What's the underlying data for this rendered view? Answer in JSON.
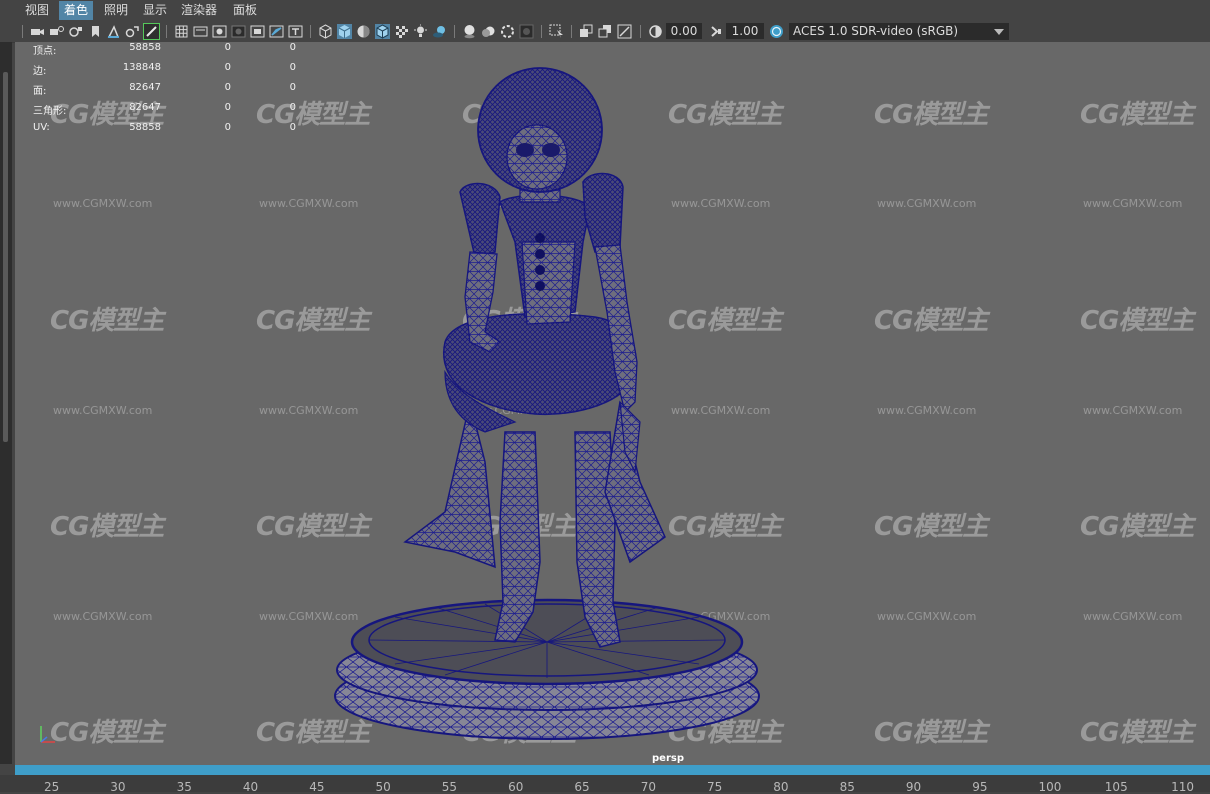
{
  "menu": {
    "items": [
      {
        "label": "视图"
      },
      {
        "label": "着色",
        "active": true
      },
      {
        "label": "照明"
      },
      {
        "label": "显示"
      },
      {
        "label": "渲染器"
      },
      {
        "label": "面板"
      }
    ]
  },
  "toolbar": {
    "exposure_value": "0.00",
    "gamma_value": "1.00",
    "color_management": "ACES 1.0 SDR-video (sRGB)",
    "icons": [
      "camera-select-icon",
      "camera-attributes-icon",
      "bookmark-icon",
      "image-plane-icon",
      "2d-pan-zoom-icon",
      "grease-pencil-icon",
      "grid-icon",
      "film-gate-icon",
      "resolution-gate-icon",
      "gate-mask-icon",
      "field-chart-icon",
      "safe-action-icon",
      "safe-title-icon",
      "wireframe-icon",
      "smooth-shade-icon",
      "default-material-icon",
      "wireframe-on-shaded-icon",
      "xray-icon",
      "use-all-lights-icon",
      "shadows-icon",
      "screen-space-ao-icon",
      "motion-blur-icon",
      "multisample-aa-icon",
      "depth-of-field-icon",
      "isolate-select-icon",
      "xray-joints-icon",
      "xray-active-icon",
      "backface-culling-icon",
      "exposure-icon",
      "gamma-icon",
      "color-management-icon"
    ]
  },
  "hud": {
    "rows": [
      {
        "label": "顶点:",
        "v1": "58858",
        "v2": "0",
        "v3": "0"
      },
      {
        "label": "边:",
        "v1": "138848",
        "v2": "0",
        "v3": "0"
      },
      {
        "label": "面:",
        "v1": "82647",
        "v2": "0",
        "v3": "0"
      },
      {
        "label": "三角形:",
        "v1": "82647",
        "v2": "0",
        "v3": "0"
      },
      {
        "label": "UV:",
        "v1": "58858",
        "v2": "0",
        "v3": "0"
      }
    ]
  },
  "viewport": {
    "camera_label": "persp",
    "watermark_logo": "CG模型主",
    "watermark_url": "www.CGMXW.com",
    "background_color": "#686868",
    "wireframe_color": "#1a1a8c"
  },
  "timeline": {
    "ticks": [
      "25",
      "30",
      "35",
      "40",
      "45",
      "50",
      "55",
      "60",
      "65",
      "70",
      "75",
      "80",
      "85",
      "90",
      "95",
      "100",
      "105",
      "110"
    ],
    "accent_color": "#3f9ec9"
  }
}
